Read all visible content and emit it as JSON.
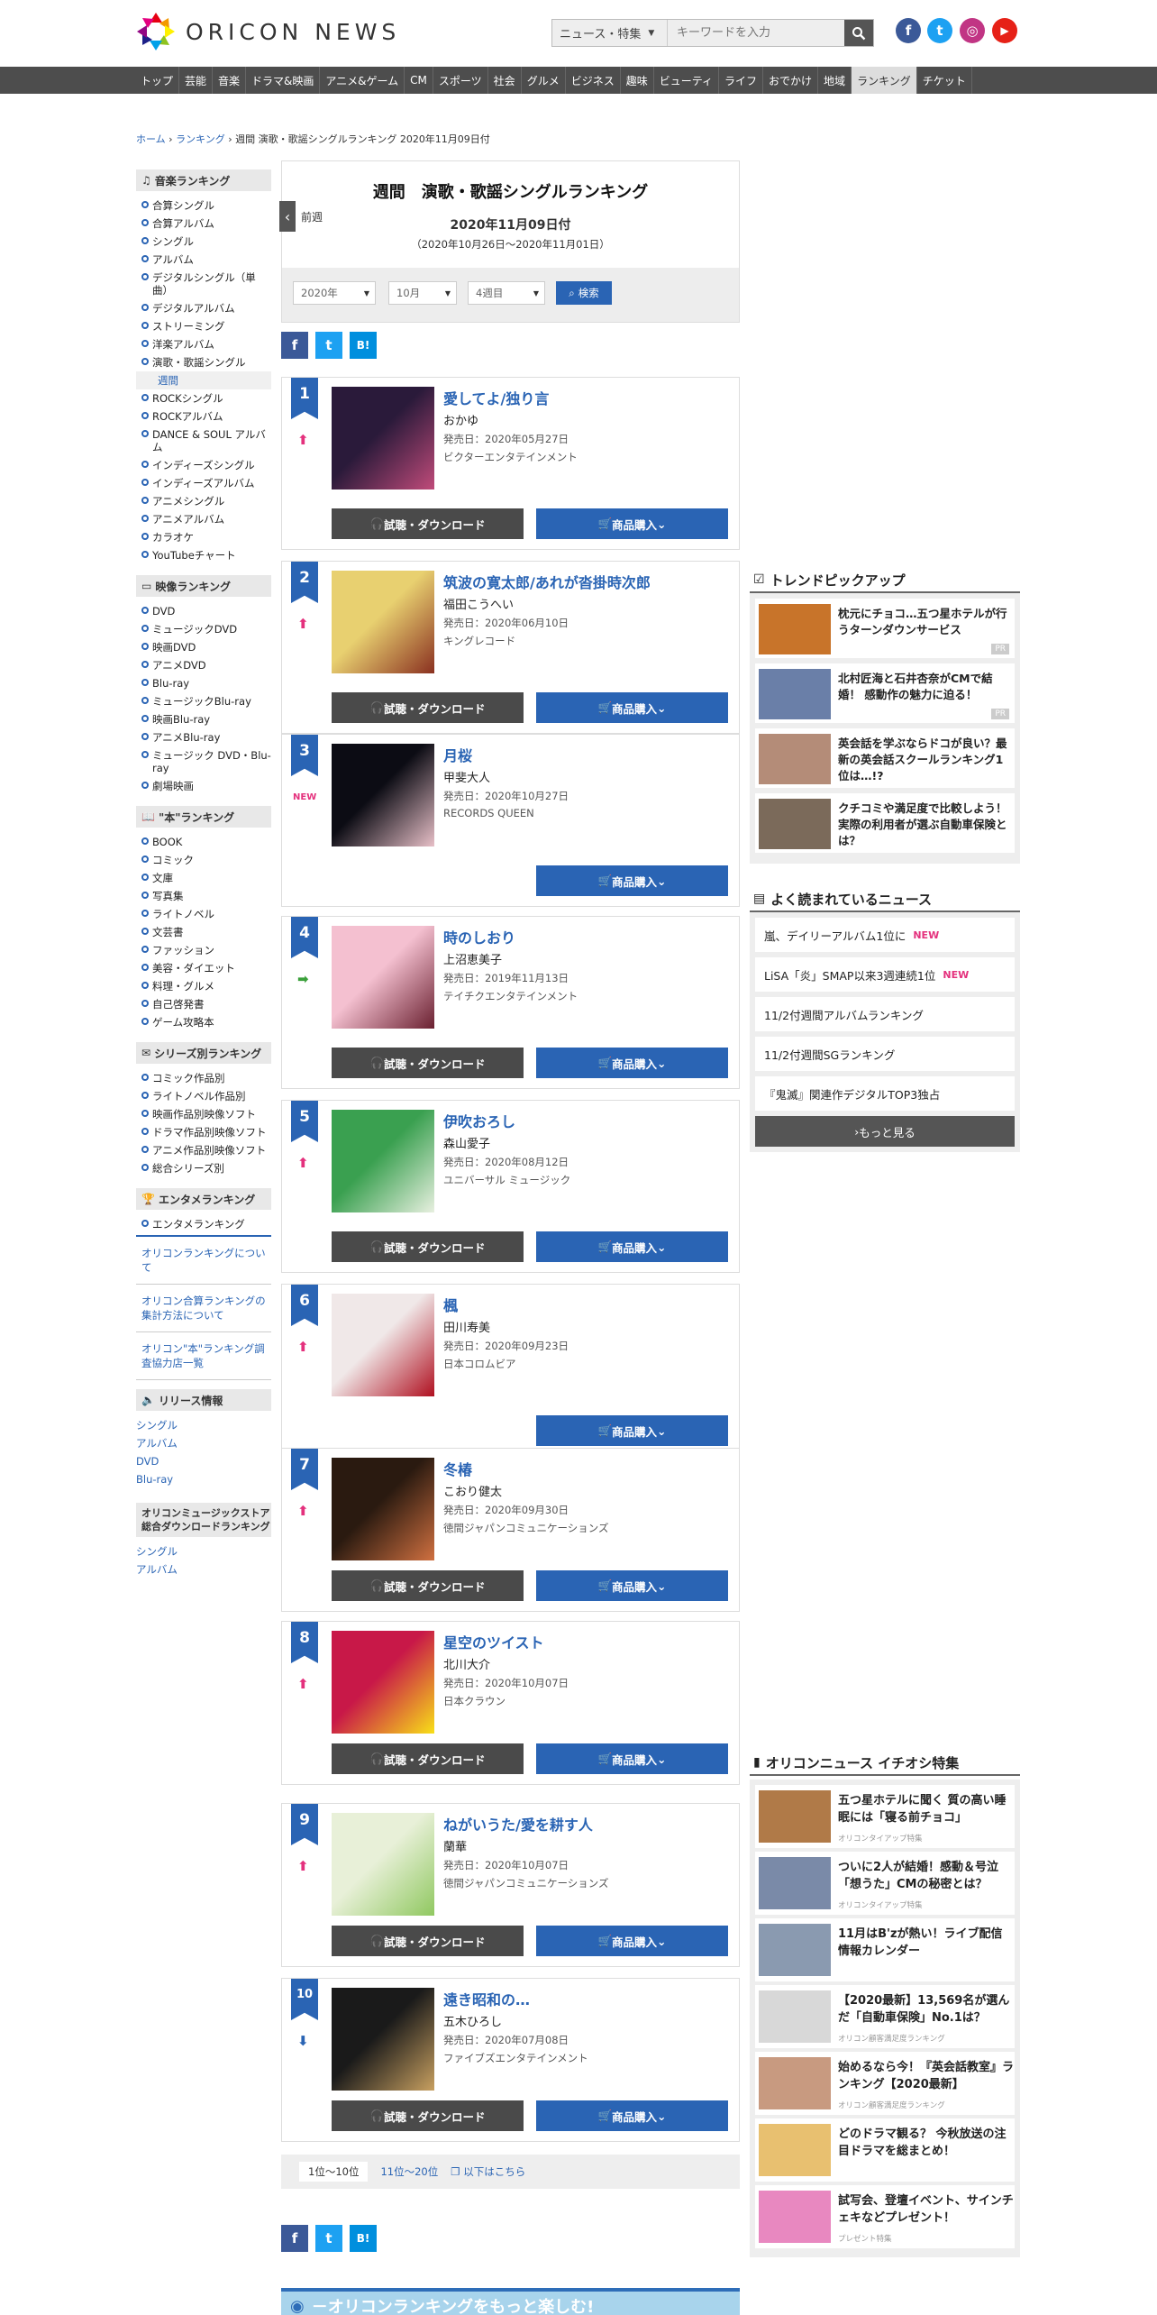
{
  "header": {
    "logo_text": "ORICON NEWS",
    "search_category": "ニュース・特集",
    "search_placeholder": "キーワードを入力",
    "social": [
      {
        "name": "facebook",
        "color": "#3b5998",
        "glyph": "f"
      },
      {
        "name": "twitter",
        "color": "#1da1f2",
        "glyph": "t"
      },
      {
        "name": "instagram",
        "color": "#c13584",
        "glyph": "◎"
      },
      {
        "name": "youtube",
        "color": "#e62117",
        "glyph": "▶"
      }
    ]
  },
  "nav": [
    "トップ",
    "芸能",
    "音楽",
    "ドラマ&映画",
    "アニメ&ゲーム",
    "CM",
    "スポーツ",
    "社会",
    "グルメ",
    "ビジネス",
    "趣味",
    "ビューティ",
    "ライフ",
    "おでかけ",
    "地域",
    "ランキング",
    "チケット"
  ],
  "nav_active": "ランキング",
  "breadcrumb": {
    "home": "ホーム",
    "ranking": "ランキング",
    "current": "週間 演歌・歌謡シングルランキング 2020年11月09日付"
  },
  "sidebar": {
    "music_head": "音楽ランキング",
    "music": [
      "合算シングル",
      "合算アルバム",
      "シングル",
      "アルバム",
      "デジタルシングル（単曲）",
      "デジタルアルバム",
      "ストリーミング",
      "洋楽アルバム",
      "演歌・歌謡シングル"
    ],
    "music_sub": "週間",
    "music2": [
      "ROCKシングル",
      "ROCKアルバム",
      "DANCE & SOUL アルバム",
      "インディーズシングル",
      "インディーズアルバム",
      "アニメシングル",
      "アニメアルバム",
      "カラオケ",
      "YouTubeチャート"
    ],
    "video_head": "映像ランキング",
    "video": [
      "DVD",
      "ミュージックDVD",
      "映画DVD",
      "アニメDVD",
      "Blu-ray",
      "ミュージックBlu-ray",
      "映画Blu-ray",
      "アニメBlu-ray",
      "ミュージック DVD・Blu-ray",
      "劇場映画"
    ],
    "book_head": "\"本\"ランキング",
    "book": [
      "BOOK",
      "コミック",
      "文庫",
      "写真集",
      "ライトノベル",
      "文芸書",
      "ファッション",
      "美容・ダイエット",
      "料理・グルメ",
      "自己啓発書",
      "ゲーム攻略本"
    ],
    "series_head": "シリーズ別ランキング",
    "series": [
      "コミック作品別",
      "ライトノベル作品別",
      "映画作品別映像ソフト",
      "ドラマ作品別映像ソフト",
      "アニメ作品別映像ソフト",
      "総合シリーズ別"
    ],
    "ent_head": "エンタメランキング",
    "ent": [
      "エンタメランキング"
    ],
    "links": [
      "オリコンランキングについて",
      "オリコン合算ランキングの集計方法について",
      "オリコン\"本\"ランキング調査協力店一覧"
    ],
    "release_head": "リリース情報",
    "release": [
      "シングル",
      "アルバム",
      "DVD",
      "Blu-ray"
    ],
    "store_head": "オリコンミュージックストア総合ダウンロードランキング",
    "store": [
      "シングル",
      "アルバム"
    ]
  },
  "main": {
    "title": "週間　演歌・歌謡シングルランキング",
    "prev": "前週",
    "date": "2020年11月09日付",
    "range": "（2020年10月26日～2020年11月01日）",
    "year": "2020年",
    "month": "10月",
    "week": "4週目",
    "search_btn": "検索",
    "dl_label": "試聴・ダウンロード",
    "buy_label": "商品購入",
    "release_prefix": "発売日：",
    "entries": [
      {
        "rank": "1",
        "trend": "up",
        "title": "愛してよ/独り言",
        "artist": "おかゆ",
        "date": "2020年05月27日",
        "label": "ビクターエンタテインメント",
        "dl": true
      },
      {
        "rank": "2",
        "trend": "up",
        "title": "筑波の寛太郎/あれが沓掛時次郎",
        "artist": "福田こうへい",
        "date": "2020年06月10日",
        "label": "キングレコード",
        "dl": true
      },
      {
        "rank": "3",
        "trend": "new",
        "title": "月桜",
        "artist": "甲斐大人",
        "date": "2020年10月27日",
        "label": "RECORDS QUEEN",
        "dl": false
      },
      {
        "rank": "4",
        "trend": "stay",
        "title": "時のしおり",
        "artist": "上沼恵美子",
        "date": "2019年11月13日",
        "label": "テイチクエンタテインメント",
        "dl": true
      },
      {
        "rank": "5",
        "trend": "up",
        "title": "伊吹おろし",
        "artist": "森山愛子",
        "date": "2020年08月12日",
        "label": "ユニバーサル ミュージック",
        "dl": true
      },
      {
        "rank": "6",
        "trend": "up",
        "title": "楓",
        "artist": "田川寿美",
        "date": "2020年09月23日",
        "label": "日本コロムビア",
        "dl": false
      },
      {
        "rank": "7",
        "trend": "up",
        "title": "冬椿",
        "artist": "こおり健太",
        "date": "2020年09月30日",
        "label": "徳間ジャパンコミュニケーションズ",
        "dl": true
      },
      {
        "rank": "8",
        "trend": "up",
        "title": "星空のツイスト",
        "artist": "北川大介",
        "date": "2020年10月07日",
        "label": "日本クラウン",
        "dl": true
      },
      {
        "rank": "9",
        "trend": "up",
        "title": "ねがいうた/愛を耕す人",
        "artist": "蘭華",
        "date": "2020年10月07日",
        "label": "徳間ジャパンコミュニケーションズ",
        "dl": true
      },
      {
        "rank": "10",
        "trend": "down",
        "title": "遠き昭和の…",
        "artist": "五木ひろし",
        "date": "2020年07月08日",
        "label": "ファイブズエンタテインメント",
        "dl": true
      }
    ],
    "pager": {
      "current": "1位～10位",
      "next": "11位～20位",
      "more": "以下はこちら"
    },
    "banner": "－オリコンランキングをもっと楽しむ!"
  },
  "right": {
    "trend_head": "トレンドピックアップ",
    "trend": [
      {
        "text": "枕元にチョコ…五つ星ホテルが行うターンダウンサービス",
        "pr": "PR",
        "color": "#c8742a"
      },
      {
        "text": "北村匠海と石井杏奈がCMで結婚！ 感動作の魅力に迫る！",
        "pr": "PR",
        "color": "#6a7fa8"
      },
      {
        "text": "英会話を学ぶならドコが良い？最新の英会話スクールランキング1位は…!?",
        "pr": "",
        "color": "#b48c78"
      },
      {
        "text": "クチコミや満足度で比較しよう！実際の利用者が選ぶ自動車保険とは？",
        "pr": "",
        "color": "#7b6a5a"
      }
    ],
    "news_head": "よく読まれているニュース",
    "news": [
      {
        "text": "嵐、デイリーアルバム1位に",
        "new": "NEW"
      },
      {
        "text": "LiSA「炎」SMAP以来3週連続1位",
        "new": "NEW"
      },
      {
        "text": "11/2付週間アルバムランキング",
        "new": ""
      },
      {
        "text": "11/2付週間SGランキング",
        "new": ""
      },
      {
        "text": "『鬼滅』関連作デジタルTOP3独占",
        "new": ""
      }
    ],
    "more": "もっと見る",
    "feat_head": "オリコンニュース イチオシ特集",
    "feat": [
      {
        "text": "五つ星ホテルに聞く 質の高い睡眠には「寝る前チョコ」",
        "sub": "オリコンタイアップ特集",
        "color": "#b07a48"
      },
      {
        "text": "ついに2人が結婚！感動＆号泣「想うた」CMの秘密とは？",
        "sub": "オリコンタイアップ特集",
        "color": "#7a8aa8"
      },
      {
        "text": "11月はB'zが熱い！ライブ配信情報カレンダー",
        "sub": "",
        "color": "#8a9ab0"
      },
      {
        "text": "【2020最新】13,569名が選んだ「自動車保険」No.1は？",
        "sub": "オリコン顧客満足度ランキング",
        "color": "#d8d8d8"
      },
      {
        "text": "始めるなら今！『英会話教室』ランキング【2020最新】",
        "sub": "オリコン顧客満足度ランキング",
        "color": "#c89a80"
      },
      {
        "text": "どのドラマ観る？ 今秋放送の注目ドラマを総まとめ！",
        "sub": "",
        "color": "#e8c070"
      },
      {
        "text": "試写会、登壇イベント、サインチェキなどプレゼント！",
        "sub": "プレゼント特集",
        "color": "#e888c0"
      }
    ]
  }
}
